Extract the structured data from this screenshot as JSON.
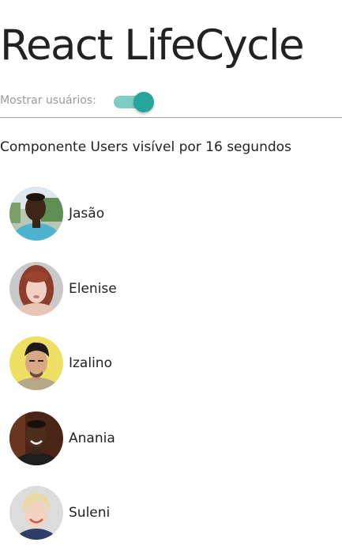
{
  "header": {
    "title": "React LifeCycle"
  },
  "controls": {
    "toggle_label": "Mostrar usuários:",
    "toggle_on": true,
    "toggle_track_color": "#80cbc4",
    "toggle_thumb_color": "#26a69a"
  },
  "status": {
    "visibility_text": "Componente Users visível por 16 segundos"
  },
  "users": [
    {
      "name": "Jasão",
      "avatar_icon": "man-outdoor-avatar"
    },
    {
      "name": "Elenise",
      "avatar_icon": "woman-red-hair-avatar"
    },
    {
      "name": "Izalino",
      "avatar_icon": "man-yellow-background-avatar"
    },
    {
      "name": "Anania",
      "avatar_icon": "man-dark-background-avatar"
    },
    {
      "name": "Suleni",
      "avatar_icon": "woman-blonde-avatar"
    }
  ]
}
